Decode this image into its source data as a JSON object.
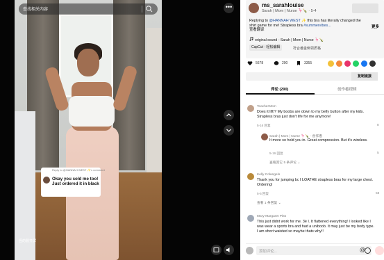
{
  "video": {
    "search_placeholder": "查找相关内容",
    "comment_sticker": {
      "reply_to": "Reply to @HANNAH WEST ✨'s comment",
      "text": "Okay you sold me too! Just ordered it in black"
    },
    "watermark": "竖的裂齐屏",
    "more_label": "•••"
  },
  "post": {
    "username": "ms_sarahlouise",
    "subline": "Sarah | Mom | Nurse 🦩🍾 · 5-4",
    "caption_prefix": "Replying to ",
    "caption_mention": "@HANNAH WEST",
    "caption_mid": " ✨ this bra has literally changed the shirt game for me! Strapless bra ",
    "caption_tag": "#summervibes...",
    "caption_translate": "查看翻译",
    "more_label": "更多",
    "sound": "original sound - Sarah | Mom | Nurse 🦩🍾",
    "capcut": "CapCut · 轻松编辑",
    "capcut_extra": "符合番金倒领质格"
  },
  "stats": {
    "likes": "5678",
    "comments": "290",
    "saves": "3355"
  },
  "share_colors": [
    "#f3c13a",
    "#f3883b",
    "#e9336b",
    "#25d366",
    "#1877f2",
    "#333333"
  ],
  "copy_link_label": "复制链接",
  "tabs": [
    {
      "label": "评论 (290)"
    },
    {
      "label": "创作者视频"
    }
  ],
  "comments": [
    {
      "name": "TeacherMom",
      "text": "Does it lift!? My boobs are down to my belly button after my kids. Strapless bras just don't life for me anymore!",
      "meta": "5-16    回复",
      "likes": "8",
      "avatar": "#c0a08a"
    },
    {
      "name": "Sarah | Mom | Nurse 🦩🍾 · 创作者",
      "text": "It more so hold you in. Great compression. But it's wireless.",
      "meta": "5-16    回复",
      "likes": "5",
      "avatar": "#8d5b48",
      "more": "查看其它 5 条评论 ⌄"
    },
    {
      "name": "Kelly Colangelo",
      "text": "Thank you for jumping bc I LOATHE strapless bras for my large chest. Ordering!",
      "meta": "5-5    回复",
      "likes": "58",
      "avatar": "#b98a3a",
      "more": "查看 1 条回复 ⌄"
    },
    {
      "name": "Mary-Margaret Pitts",
      "text": "This just didnt work for me. 3é I. It flattened everything! I looked like I was wear a sports bra and had a uniboob. It may just be my body type. I am short waisted so maybe thats why!!",
      "meta": "",
      "likes": "",
      "avatar": "#9fa8b6"
    }
  ],
  "input": {
    "placeholder": "添加评论...",
    "at": "@"
  }
}
